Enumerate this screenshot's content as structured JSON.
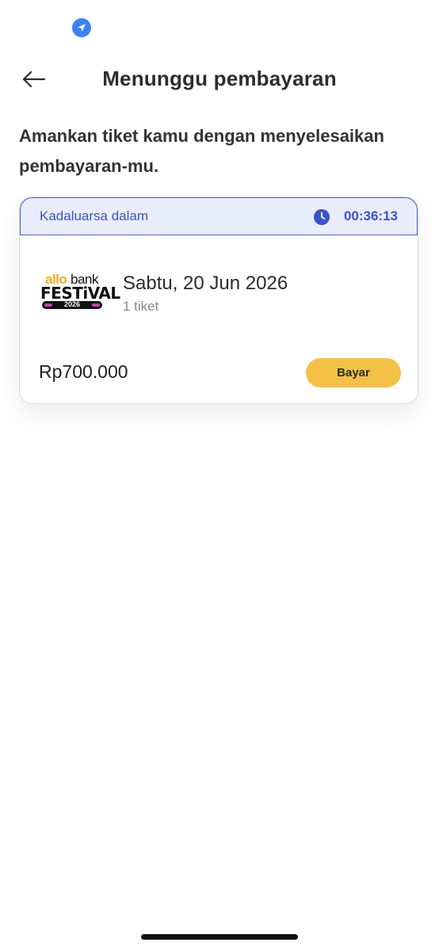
{
  "status_bar": {
    "location_icon": "location-arrow-icon"
  },
  "header": {
    "back_icon": "arrow-left-icon",
    "title": "Menunggu pembayaran"
  },
  "intro_text": "Amankan tiket kamu dengan menyelesaikan pembayaran-mu.",
  "order_card": {
    "expiry_label": "Kadaluarsa dalam",
    "clock_icon": "clock-icon",
    "countdown": "00:36:13",
    "event_logo": {
      "allo": "allo",
      "bank": "bank",
      "festival": "FESTiVAL",
      "year": "2026"
    },
    "event_date": "Sabtu, 20 Jun 2026",
    "ticket_count": "1 tiket",
    "total_price": "Rp700.000",
    "pay_label": "Bayar"
  },
  "colors": {
    "accent_blue": "#3b54c9",
    "expiry_bg": "#e9edfb",
    "pay_button": "#f3c146"
  }
}
